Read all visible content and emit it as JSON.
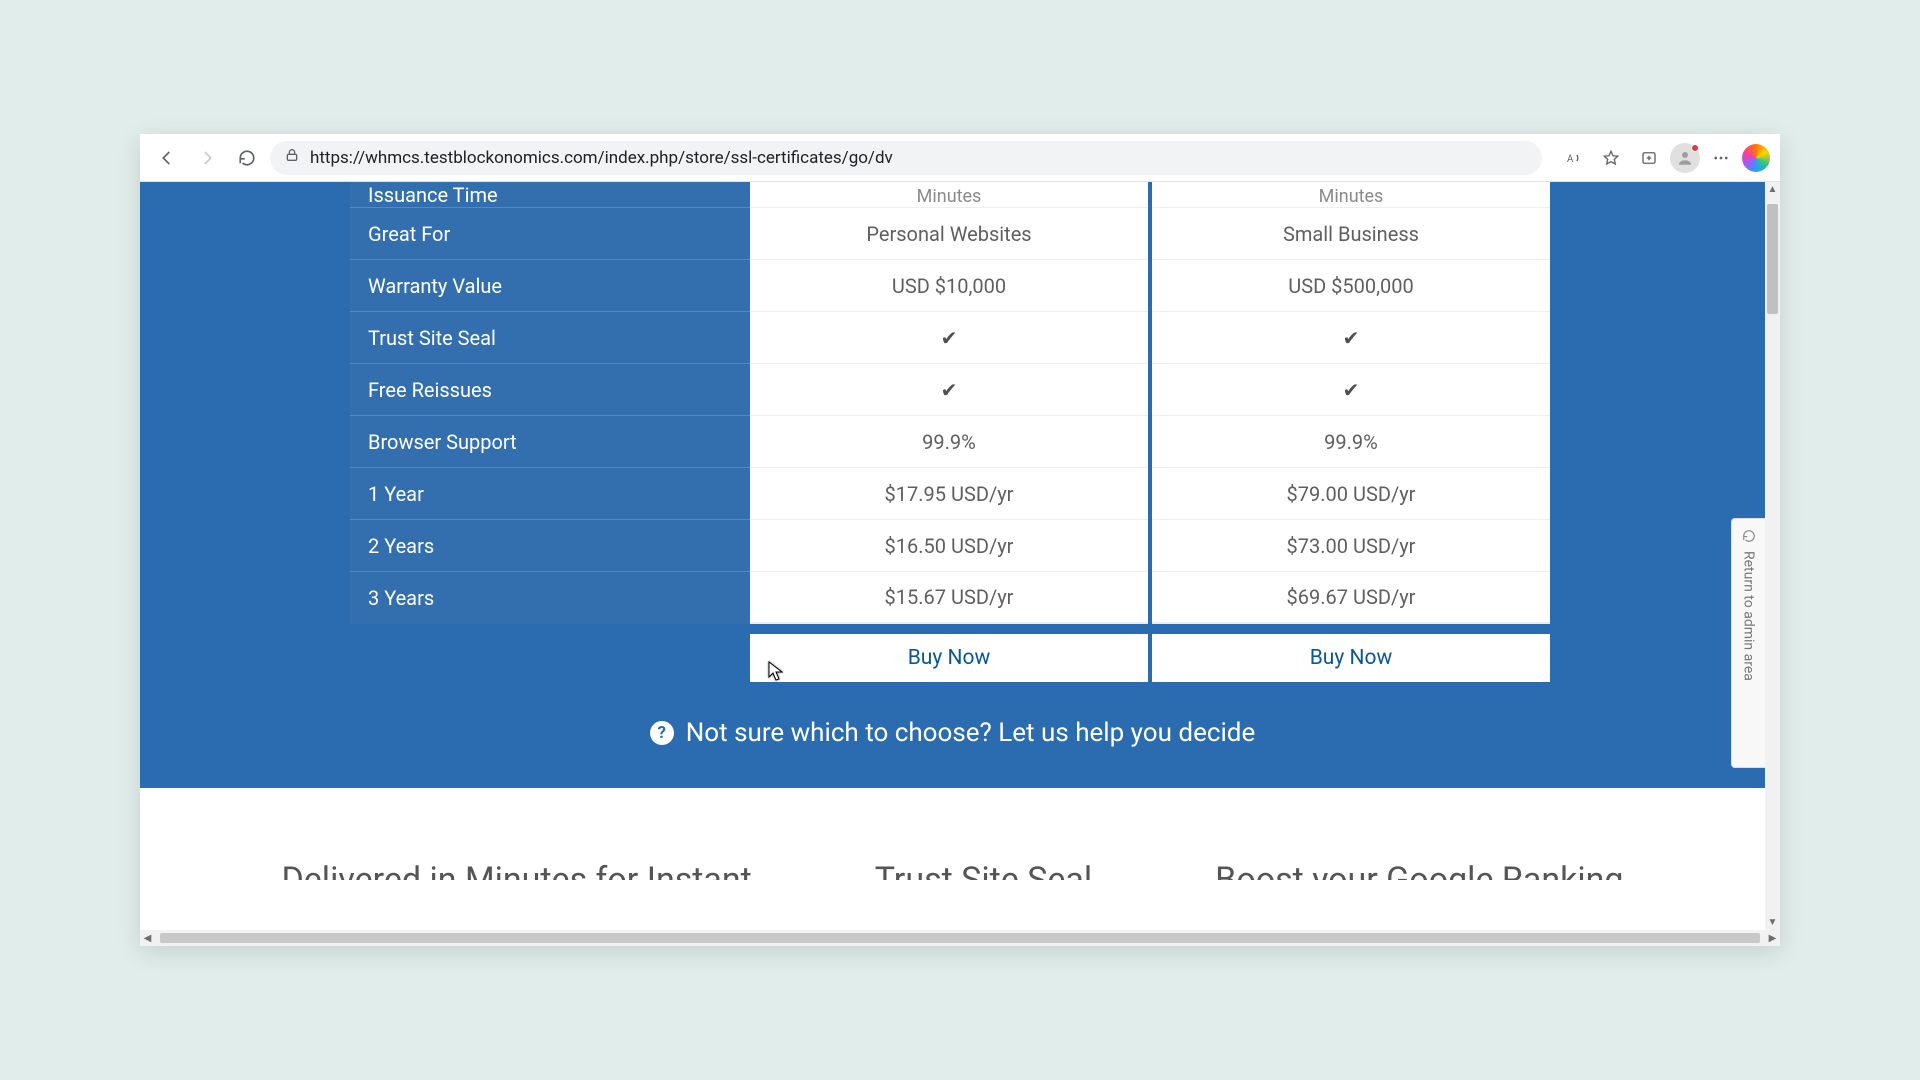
{
  "toolbar": {
    "url": "https://whmcs.testblockonomics.com/index.php/store/ssl-certificates/go/dv"
  },
  "table": {
    "topRowLabel": "Issuance Time",
    "labels": [
      "Great For",
      "Warranty Value",
      "Trust Site Seal",
      "Free Reissues",
      "Browser Support",
      "1 Year",
      "2 Years",
      "3 Years"
    ],
    "plans": [
      {
        "top": "Minutes",
        "values": [
          "Personal Websites",
          "USD $10,000",
          "__check__",
          "__check__",
          "99.9%",
          "$17.95 USD/yr",
          "$16.50 USD/yr",
          "$15.67 USD/yr"
        ],
        "buy": "Buy Now"
      },
      {
        "top": "Minutes",
        "values": [
          "Small Business",
          "USD $500,000",
          "__check__",
          "__check__",
          "99.9%",
          "$79.00 USD/yr",
          "$73.00 USD/yr",
          "$69.67 USD/yr"
        ],
        "buy": "Buy Now"
      }
    ]
  },
  "help": {
    "text": "Not sure which to choose? Let us help you decide"
  },
  "below": {
    "col1": "Delivered in Minutes for Instant",
    "col2": "Trust Site Seal",
    "col3": "Boost your Google Ranking"
  },
  "returnTab": {
    "label": "Return to admin area"
  }
}
